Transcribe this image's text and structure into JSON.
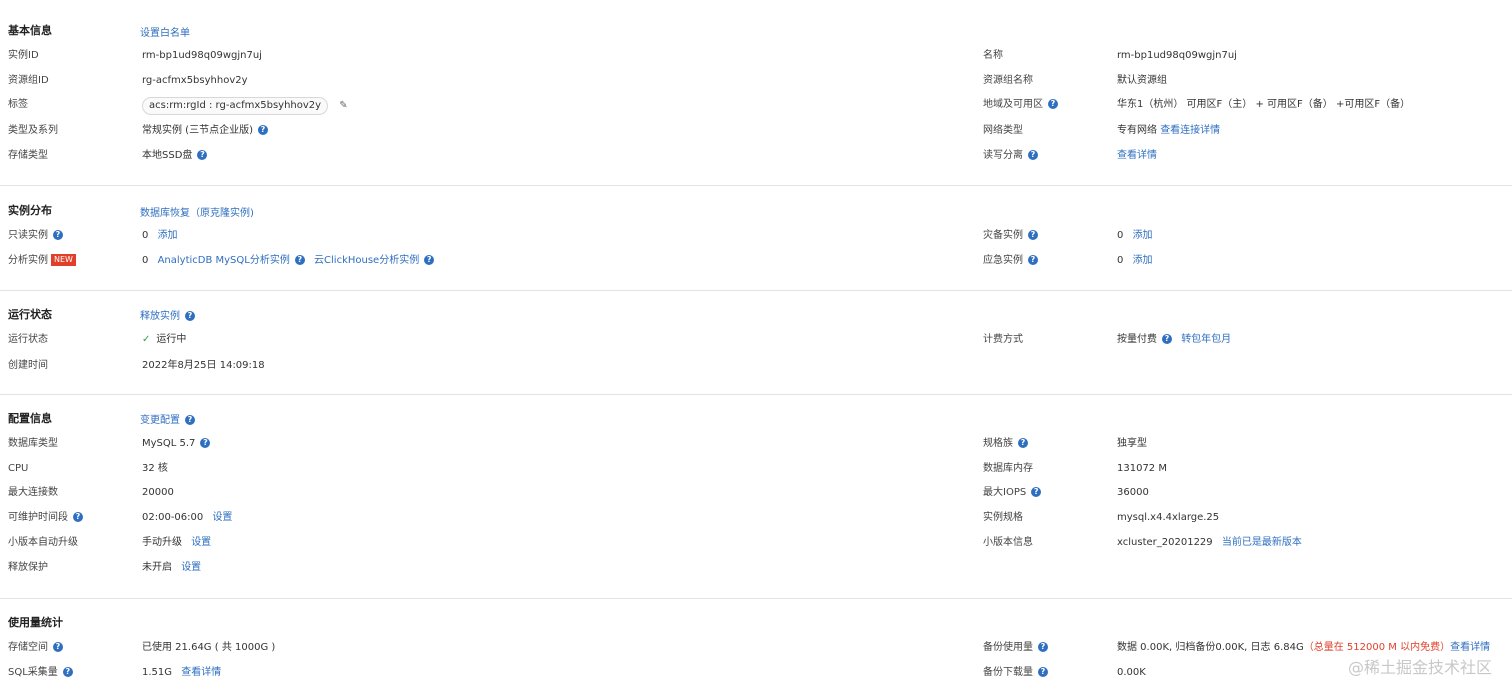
{
  "basic": {
    "title": "基本信息",
    "action": "设置白名单",
    "instance_id_label": "实例ID",
    "instance_id": "rm-bp1ud98q09wgjn7uj",
    "name_label": "名称",
    "name": "rm-bp1ud98q09wgjn7uj",
    "rg_id_label": "资源组ID",
    "rg_id": "rg-acfmx5bsyhhov2y",
    "rg_name_label": "资源组名称",
    "rg_name": "默认资源组",
    "tag_label": "标签",
    "tag": "acs:rm:rgId : rg-acfmx5bsyhhov2y",
    "region_label": "地域及可用区",
    "region": "华东1（杭州） 可用区F（主） + 可用区F（备） +可用区F（备）",
    "type_label": "类型及系列",
    "type": "常规实例 (三节点企业版)",
    "network_label": "网络类型",
    "network": "专有网络",
    "network_link": "查看连接详情",
    "storage_label": "存储类型",
    "storage": "本地SSD盘",
    "rw_label": "读写分离",
    "rw_link": "查看详情"
  },
  "dist": {
    "title": "实例分布",
    "action": "数据库恢复（原克隆实例)",
    "readonly_label": "只读实例",
    "readonly_count": "0",
    "readonly_add": "添加",
    "disaster_label": "灾备实例",
    "disaster_count": "0",
    "disaster_add": "添加",
    "analytic_label": "分析实例",
    "analytic_badge": "NEW",
    "analytic_count": "0",
    "analytic_link1": "AnalyticDB MySQL分析实例",
    "analytic_link2": "云ClickHouse分析实例",
    "emergency_label": "应急实例",
    "emergency_count": "0",
    "emergency_add": "添加"
  },
  "status": {
    "title": "运行状态",
    "action": "释放实例",
    "run_label": "运行状态",
    "run_value": "运行中",
    "billing_label": "计费方式",
    "billing_value": "按量付费",
    "billing_link": "转包年包月",
    "created_label": "创建时间",
    "created_value": "2022年8月25日 14:09:18"
  },
  "config": {
    "title": "配置信息",
    "action": "变更配置",
    "dbtype_label": "数据库类型",
    "dbtype": "MySQL  5.7",
    "spec_family_label": "规格族",
    "spec_family": "独享型",
    "cpu_label": "CPU",
    "cpu": "32 核",
    "mem_label": "数据库内存",
    "mem": "131072 M",
    "maxconn_label": "最大连接数",
    "maxconn": "20000",
    "iops_label": "最大IOPS",
    "iops": "36000",
    "maint_label": "可维护时间段",
    "maint": "02:00-06:00",
    "maint_link": "设置",
    "spec_label": "实例规格",
    "spec": "mysql.x4.4xlarge.25",
    "upgrade_label": "小版本自动升级",
    "upgrade": "手动升级",
    "upgrade_link": "设置",
    "minor_label": "小版本信息",
    "minor": "xcluster_20201229",
    "minor_link": "当前已是最新版本",
    "release_label": "释放保护",
    "release": "未开启",
    "release_link": "设置"
  },
  "usage": {
    "title": "使用量统计",
    "storage_label": "存储空间",
    "storage": "已使用 21.64G ( 共 1000G )",
    "backup_label": "备份使用量",
    "backup": "数据 0.00K, 归档备份0.00K, 日志 6.84G",
    "backup_note": "（总量在 512000 M 以内免费）",
    "backup_link": "查看详情",
    "sql_label": "SQL采集量",
    "sql": "1.51G",
    "sql_link": "查看详情",
    "download_label": "备份下载量",
    "download": "0.00K"
  },
  "watermark": "@稀土掘金技术社区",
  "colors": {
    "link": "#2f6fc0",
    "red": "#e0402a",
    "divider": "#e3e3e3",
    "ok": "#2ea043"
  },
  "icons": {
    "help": "question-circle-icon",
    "edit": "pencil-icon",
    "check": "checkmark-icon"
  }
}
